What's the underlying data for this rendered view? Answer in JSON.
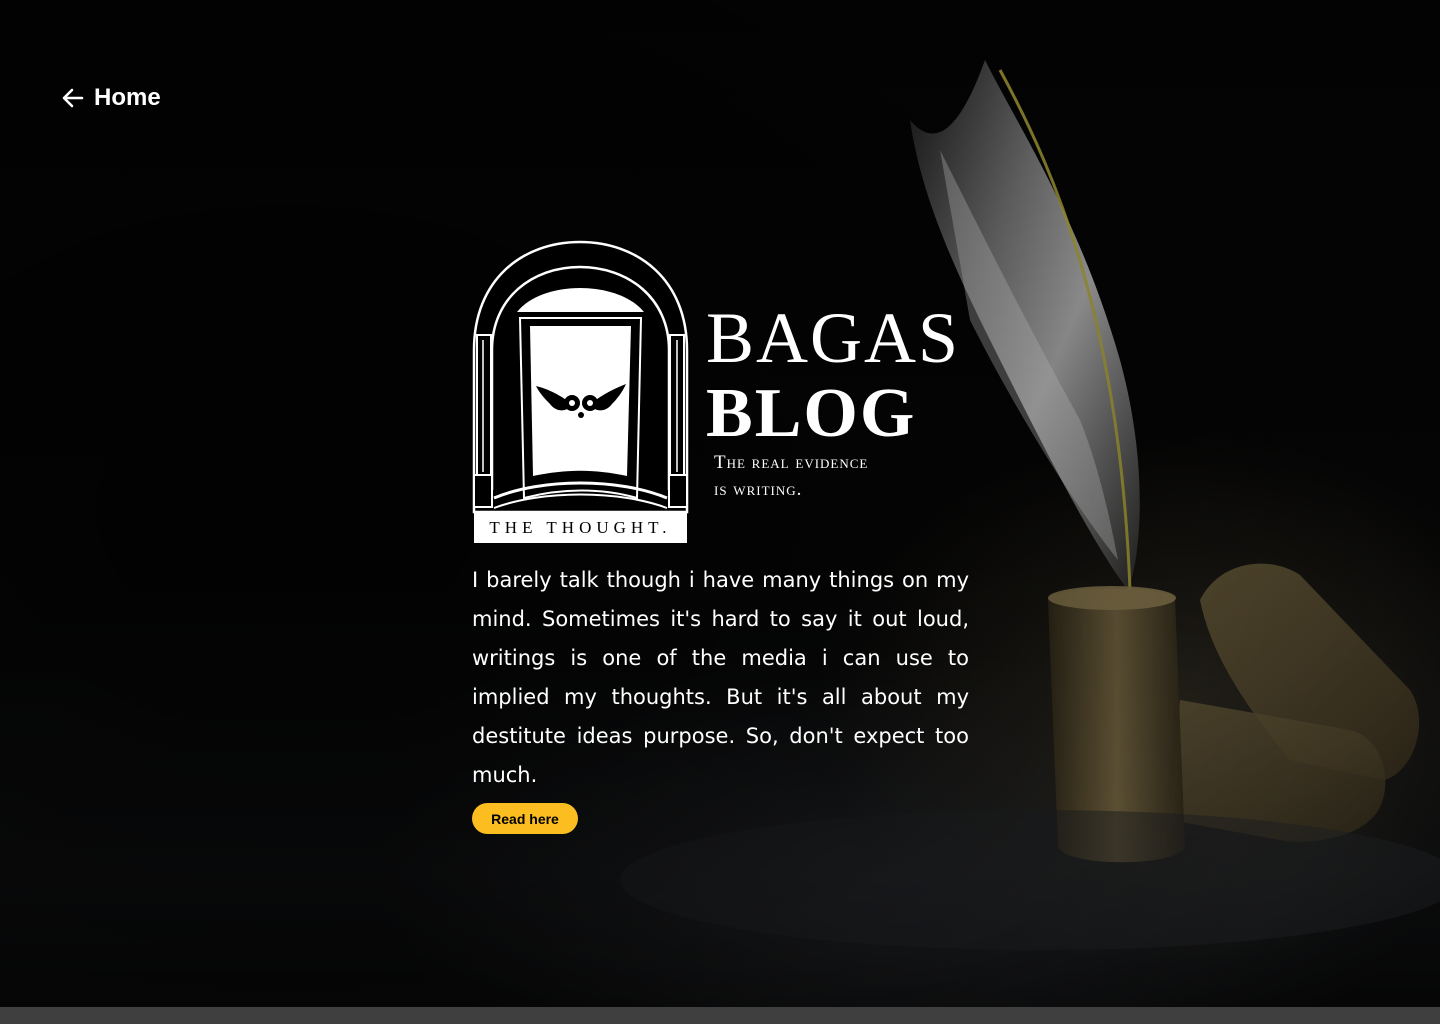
{
  "nav": {
    "home_label": "Home"
  },
  "brand": {
    "badge_caption": "THE THOUGHT.",
    "title_line1": "BAGAS",
    "title_line2": "BLOG",
    "tagline_line1": "The real evidence",
    "tagline_line2": "is writing."
  },
  "intro": {
    "text": "I barely talk though i have many things on my mind. Sometimes it's hard to say it out loud, writings is one of the media i can use to implied my thoughts. But it's all about my destitute ideas purpose. So, don't expect too much."
  },
  "cta": {
    "read_label": "Read here"
  },
  "colors": {
    "accent": "#fbbd1f",
    "background": "#000000",
    "text": "#ffffff",
    "bottom_bar": "#3f3f3f"
  },
  "icons": {
    "back": "arrow-left-icon",
    "badge_emblem": "winged-owl-icon"
  }
}
